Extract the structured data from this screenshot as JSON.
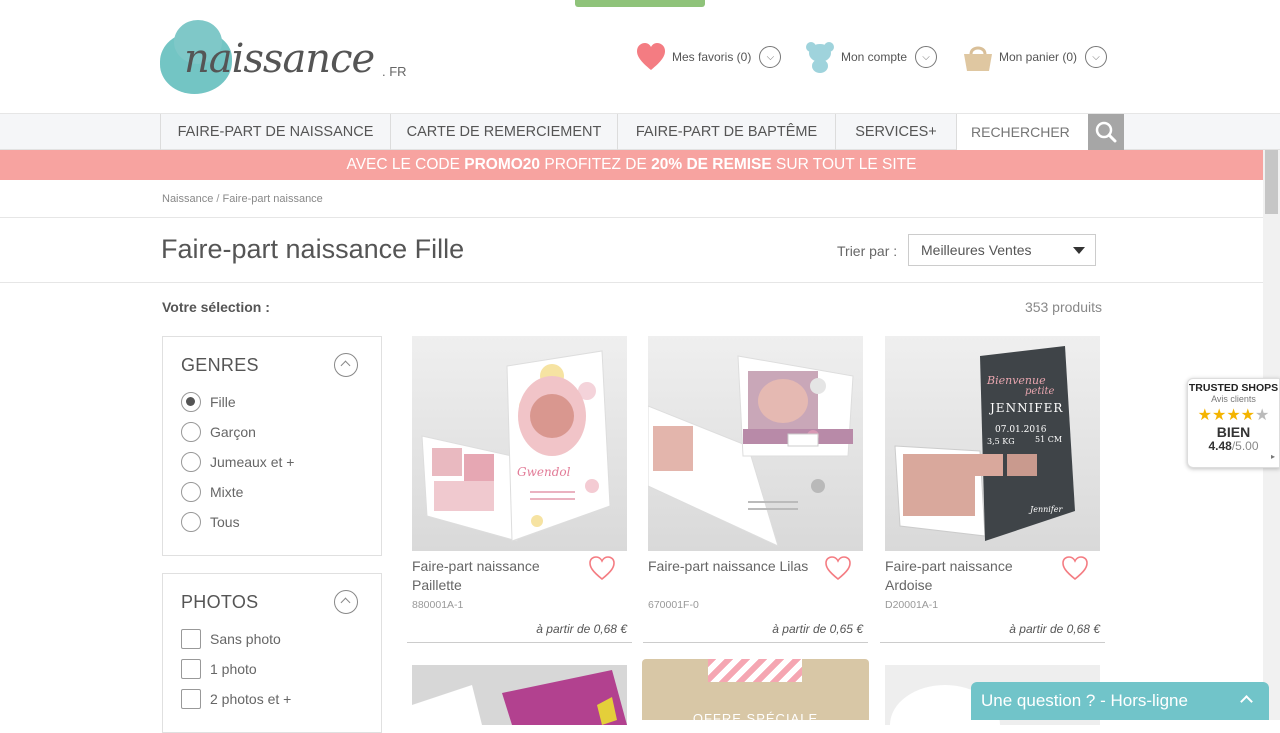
{
  "header": {
    "logo_word": "naissance",
    "logo_suffix": ". FR",
    "favorites_label": "Mes favoris (0)",
    "account_label": "Mon compte",
    "cart_label": "Mon panier (0)"
  },
  "nav": {
    "items": [
      "FAIRE-PART DE NAISSANCE",
      "CARTE DE REMERCIEMENT",
      "FAIRE-PART DE BAPTÊME",
      "SERVICES+"
    ],
    "search_placeholder": "RECHERCHER"
  },
  "promo": {
    "part1": "AVEC LE CODE ",
    "code": "PROMO20",
    "part2": " PROFITEZ DE ",
    "discount": "20% DE REMISE",
    "part3": " SUR TOUT LE SITE"
  },
  "breadcrumb": {
    "home": "Naissance",
    "separator": " / ",
    "current": "Faire-part naissance"
  },
  "page": {
    "title": "Faire-part naissance Fille",
    "sort_label": "Trier par :",
    "sort_value": "Meilleures Ventes",
    "selection_label": "Votre sélection :",
    "product_count": "353 produits"
  },
  "filters": {
    "genres": {
      "title": "GENRES",
      "options": [
        "Fille",
        "Garçon",
        "Jumeaux et +",
        "Mixte",
        "Tous"
      ],
      "selected": "Fille"
    },
    "photos": {
      "title": "PHOTOS",
      "options": [
        "Sans photo",
        "1 photo",
        "2 photos et +"
      ]
    }
  },
  "products": [
    {
      "name": "Faire-part naissance Paillette",
      "ref": "880001A-1",
      "price": "à partir de 0,68 €"
    },
    {
      "name": "Faire-part naissance Lilas",
      "ref": "670001F-0",
      "price": "à partir de 0,65 €"
    },
    {
      "name": "Faire-part naissance Ardoise",
      "ref": "D20001A-1",
      "price": "à partir de 0,68 €"
    }
  ],
  "product_images": {
    "p1_script": "Gwendol",
    "p3_line1": "Bienvenue",
    "p3_line2": "petite",
    "p3_name": "JENNIFER",
    "p3_date": "07.01.2016",
    "p3_weight": "3,5 KG",
    "p3_height": "51 CM",
    "p3_sign": "Jennifer"
  },
  "offer_teaser": "OFFRE SPÉCIALE",
  "trusted_shops": {
    "title": "TRUSTED SHOPS",
    "subtitle": "Avis clients",
    "rating_word": "BIEN",
    "score": "4.48",
    "scale": "/5.00",
    "stars": 4
  },
  "chat": {
    "label": "Une question ? - Hors-ligne"
  },
  "colors": {
    "promo_bg": "#f7a3a0",
    "chat_bg": "#71c4c9",
    "logo_blob": "#73c5c4",
    "heart": "#f47c82"
  }
}
